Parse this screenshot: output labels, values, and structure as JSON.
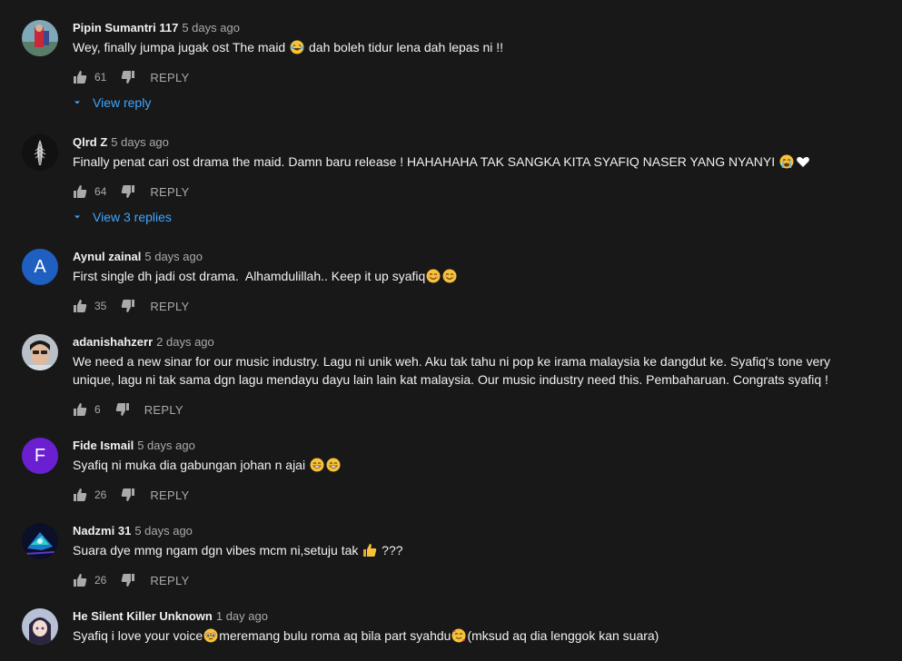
{
  "colors": {
    "background": "#181818",
    "text_primary": "#f1f1f1",
    "text_secondary": "#aaaaaa",
    "link_blue": "#3ea6ff",
    "avatar_a": "#1e5fc1",
    "avatar_f": "#6a1fd0"
  },
  "comments": [
    {
      "author": "Pipin Sumantri 117",
      "time": "5 days ago",
      "text_parts": [
        "Wey, finally jumpa jugak ost The maid ",
        " dah boleh tidur lena dah lepas ni !!"
      ],
      "likes": "61",
      "reply_label": "REPLY",
      "view_replies": "View reply",
      "avatar": "photo-portrait"
    },
    {
      "author": "Qlrd Z",
      "time": "5 days ago",
      "text_parts": [
        "Finally penat cari ost drama the maid. Damn baru release ! HAHAHAHA TAK SANGKA KITA SYAFIQ NASER YANG NYANYI "
      ],
      "likes": "64",
      "reply_label": "REPLY",
      "view_replies": "View 3 replies",
      "avatar": "dark-feather"
    },
    {
      "author": "Aynul zainal",
      "time": "5 days ago",
      "text_parts": [
        "First single dh jadi ost drama.  Alhamdulillah.. Keep it up syafiq"
      ],
      "likes": "35",
      "reply_label": "REPLY",
      "avatar_letter": "A"
    },
    {
      "author": "adanishahzerr",
      "time": "2 days ago",
      "text_parts": [
        "We need a new sinar for our music industry. Lagu ni unik weh. Aku tak tahu ni pop ke irama malaysia ke dangdut ke. Syafiq's tone very unique, lagu ni tak sama dgn lagu mendayu dayu lain lain kat malaysia. Our music industry need this. Pembaharuan. Congrats syafiq !"
      ],
      "likes": "6",
      "reply_label": "REPLY",
      "avatar": "photo-face"
    },
    {
      "author": "Fide Ismail",
      "time": "5 days ago",
      "text_parts": [
        "Syafiq ni muka dia gabungan johan n ajai "
      ],
      "likes": "26",
      "reply_label": "REPLY",
      "avatar_letter": "F"
    },
    {
      "author": "Nadzmi 31",
      "time": "5 days ago",
      "text_parts": [
        "Suara dye mmg ngam dgn vibes mcm ni,setuju tak ",
        " ???"
      ],
      "likes": "26",
      "reply_label": "REPLY",
      "avatar": "game-art"
    },
    {
      "author": "He Silent Killer Unknown",
      "time": "1 day ago",
      "text_parts": [
        "Syafiq i love your voice",
        "meremang bulu roma aq bila part syahdu",
        "(mksud aq dia lenggok kan suara)"
      ],
      "avatar": "anime-portrait"
    }
  ]
}
